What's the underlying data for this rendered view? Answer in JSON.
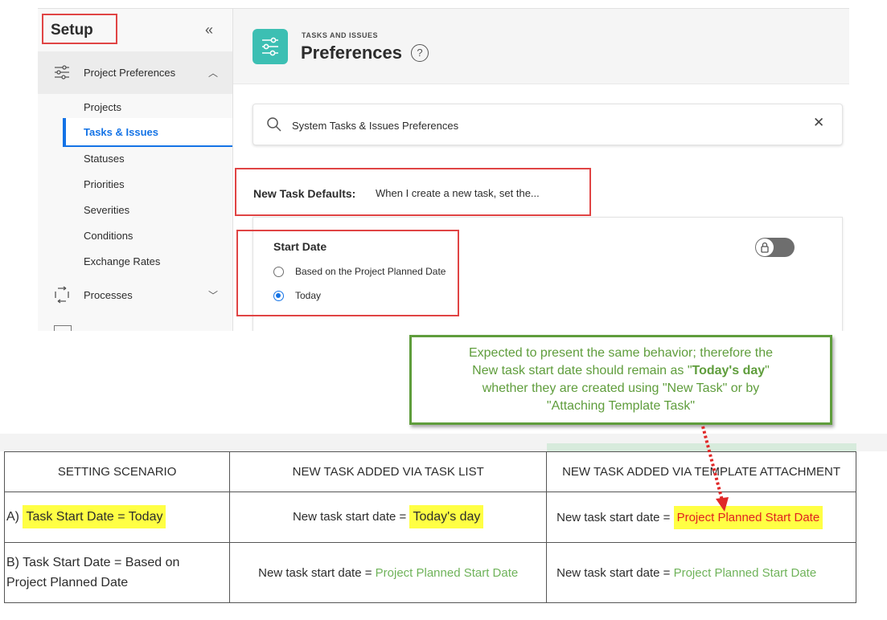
{
  "sidebar": {
    "title": "Setup",
    "collapse_icon": "double-chevron-left-icon",
    "project_preferences": "Project Preferences",
    "sub_items": [
      "Projects",
      "Tasks & Issues",
      "Statuses",
      "Priorities",
      "Severities",
      "Conditions",
      "Exchange Rates"
    ],
    "processes": "Processes"
  },
  "header": {
    "eyebrow": "TASKS AND ISSUES",
    "title": "Preferences",
    "help": "?"
  },
  "search": {
    "value": "System Tasks & Issues Preferences"
  },
  "defaults": {
    "label": "New Task Defaults:",
    "text": "When I create a new task, set the..."
  },
  "start_date": {
    "title": "Start Date",
    "options": [
      "Based on the Project Planned Date",
      "Today"
    ],
    "selected": "Today"
  },
  "callout": {
    "line1": "Expected to present the same behavior; therefore the",
    "line2_prefix": "New task start date should remain as \"",
    "line2_bold": "Today's day",
    "line2_suffix": "\"",
    "line3": "whether they are created using \"New Task\" or by",
    "line4": "\"Attaching Template Task\""
  },
  "table": {
    "headers": [
      "SETTING SCENARIO",
      "NEW TASK ADDED VIA TASK LIST",
      "NEW TASK ADDED VIA TEMPLATE ATTACHMENT"
    ],
    "rows": [
      {
        "scenario_prefix": "A) ",
        "scenario_hl": "Task Start Date = Today",
        "task_list_prefix": "New task start date = ",
        "task_list_value": "Today's day",
        "template_prefix": "New task start date = ",
        "template_value": "Project Planned Start Date"
      },
      {
        "scenario": "B) Task Start Date = Based on Project Planned Date",
        "task_list_prefix": "New task start date = ",
        "task_list_value": "Project Planned Start Date",
        "template_prefix": "New task start date = ",
        "template_value": "Project Planned Start Date"
      }
    ]
  },
  "colors": {
    "accent_blue": "#1473e6",
    "highlight_red": "#e04444",
    "callout_green": "#5f9d3c",
    "teal_icon": "#3cbfb3"
  }
}
